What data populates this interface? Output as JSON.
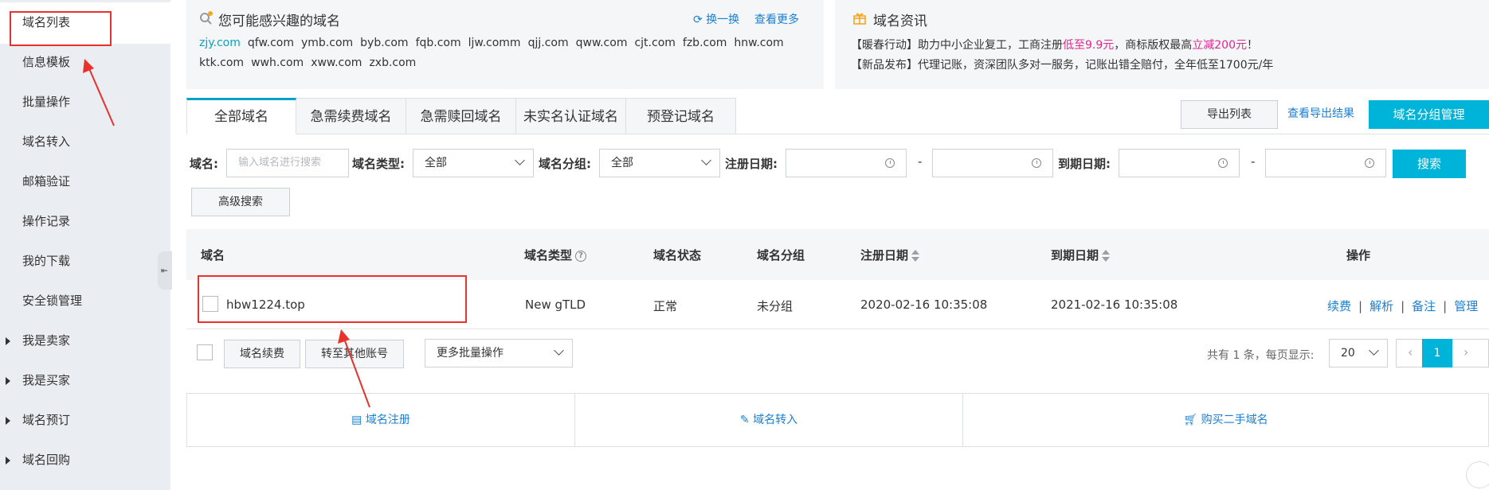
{
  "sidebar": {
    "items": [
      {
        "label": "域名列表"
      },
      {
        "label": "信息模板"
      },
      {
        "label": "批量操作"
      },
      {
        "label": "域名转入"
      },
      {
        "label": "邮箱验证"
      },
      {
        "label": "操作记录"
      },
      {
        "label": "我的下载"
      },
      {
        "label": "安全锁管理"
      },
      {
        "label": "我是卖家"
      },
      {
        "label": "我是买家"
      },
      {
        "label": "域名预订"
      },
      {
        "label": "域名回购"
      }
    ],
    "collapse_glyph": "⇤"
  },
  "suggest": {
    "title": "您可能感兴趣的域名",
    "refresh": "换一换",
    "more": "查看更多",
    "line1": [
      "zjy.com",
      "qfw.com",
      "ymb.com",
      "byb.com",
      "fqb.com",
      "ljw.comm",
      "qjj.com",
      "qww.com",
      "cjt.com",
      "fzb.com",
      "hnw.com"
    ],
    "line2": [
      "ktk.com",
      "wwh.com",
      "xww.com",
      "zxb.com"
    ]
  },
  "news": {
    "title": "域名资讯",
    "line1": {
      "a": "【暖春行动】助力中小企业复工，工商注册",
      "b": "低至9.9元",
      "c": "，商标版权最高",
      "d": "立减200元",
      "e": "！"
    },
    "line2": "【新品发布】代理记账，资深团队多对一服务，记账出错全赔付，全年低至1700元/年"
  },
  "tabs": [
    "全部域名",
    "急需续费域名",
    "急需赎回域名",
    "未实名认证域名",
    "预登记域名"
  ],
  "toolbar": {
    "export": "导出列表",
    "view_export": "查看导出结果",
    "group_mgmt": "域名分组管理"
  },
  "search": {
    "domain_label": "域名:",
    "domain_placeholder": "输入域名进行搜索",
    "type_label": "域名类型:",
    "type_value": "全部",
    "group_label": "域名分组:",
    "group_value": "全部",
    "reg_label": "注册日期:",
    "exp_label": "到期日期:",
    "dash": "-",
    "search_btn": "搜索",
    "advanced_btn": "高级搜索"
  },
  "table": {
    "headers": {
      "domain": "域名",
      "type": "域名类型",
      "status": "域名状态",
      "group": "域名分组",
      "reg_date": "注册日期",
      "exp_date": "到期日期",
      "ops": "操作"
    },
    "rows": [
      {
        "domain": "hbw1224.top",
        "type": "New gTLD",
        "status": "正常",
        "group": "未分组",
        "reg_date": "2020-02-16 10:35:08",
        "exp_date": "2021-02-16 10:35:08",
        "ops": [
          "续费",
          "解析",
          "备注",
          "管理"
        ]
      }
    ]
  },
  "batch": {
    "renew": "域名续费",
    "transfer": "转至其他账号",
    "more": "更多批量操作"
  },
  "pager": {
    "info": "共有 1 条，每页显示:",
    "page_size": "20",
    "prev": "‹",
    "current": "1",
    "next": "›"
  },
  "bottom": {
    "register": "域名注册",
    "transfer_in": "域名转入",
    "buy_used": "购买二手域名"
  },
  "colors": {
    "accent": "#00b3d8",
    "link": "#1a7fd5",
    "annotation": "#e8322b",
    "promo": "#e2288c"
  }
}
